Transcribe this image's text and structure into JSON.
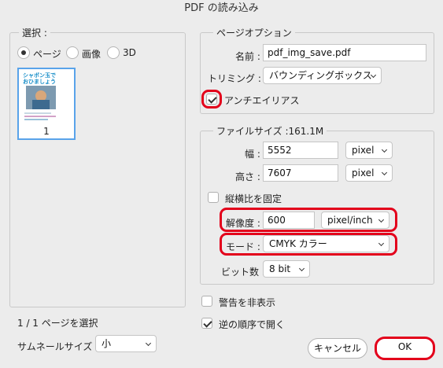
{
  "window": {
    "title": "PDF の読み込み"
  },
  "select_group": {
    "legend": "選択 :",
    "options": [
      {
        "label": "ページ",
        "selected": true
      },
      {
        "label": "画像",
        "selected": false
      },
      {
        "label": "3D",
        "selected": false
      }
    ],
    "thumbnail": {
      "page_number": "1",
      "caption_line1": "シャボン玉で",
      "caption_line2": "おひましょう"
    },
    "selection_status": "1 / 1 ページを選択",
    "thumb_size_label": "サムネールサイズ :",
    "thumb_size_value": "小"
  },
  "page_options": {
    "legend": "ページオプション",
    "name_label": "名前 :",
    "name_value": "pdf_img_save.pdf",
    "crop_label": "トリミング :",
    "crop_value": "バウンディングボックス",
    "antialias_label": "アンチエイリアス",
    "antialias_checked": true
  },
  "image_size": {
    "legend": "ファイルサイズ :161.1M",
    "width_label": "幅 :",
    "width_value": "5552",
    "width_unit": "pixel",
    "height_label": "高さ :",
    "height_value": "7607",
    "height_unit": "pixel",
    "constrain_label": "縦横比を固定",
    "constrain_checked": false,
    "resolution_label": "解像度 :",
    "resolution_value": "600",
    "resolution_unit": "pixel/inch",
    "mode_label": "モード :",
    "mode_value": "CMYK カラー",
    "depth_label": "ビット数 :",
    "depth_value": "8 bit"
  },
  "options": {
    "suppress_warnings_label": "警告を非表示",
    "suppress_warnings_checked": false,
    "reverse_order_label": "逆の順序で開く",
    "reverse_order_checked": true
  },
  "buttons": {
    "cancel": "キャンセル",
    "ok": "OK"
  },
  "colors": {
    "highlight": "#e3001b",
    "background": "#ececec"
  }
}
